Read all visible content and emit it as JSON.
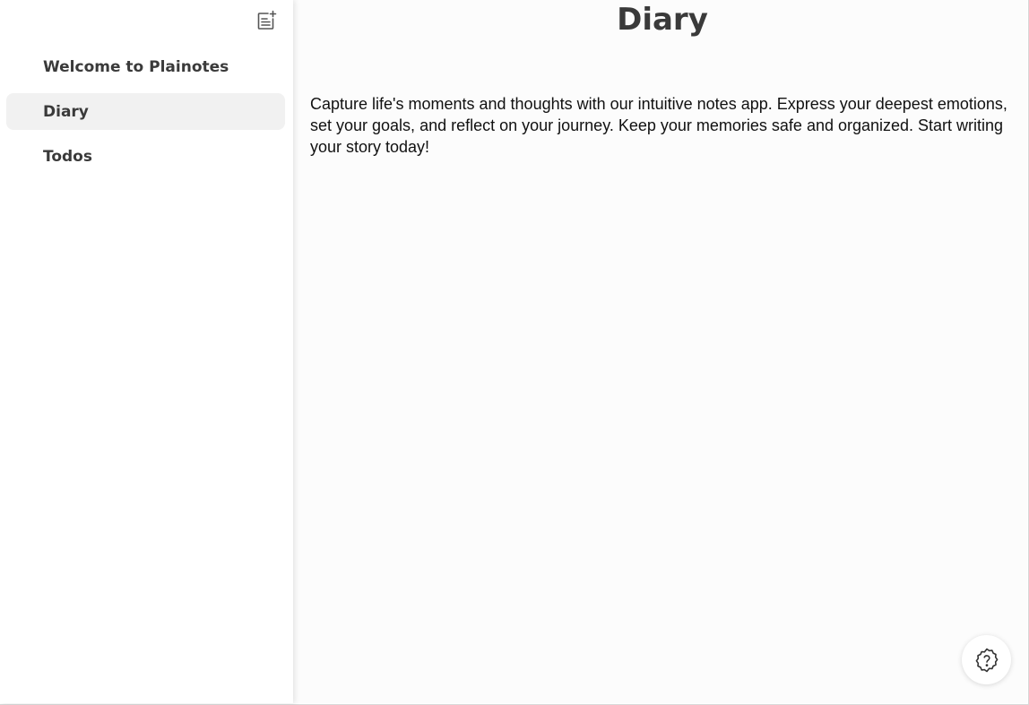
{
  "sidebar": {
    "new_note_icon": "note-add-icon",
    "items": [
      {
        "label": "Welcome to Plainotes",
        "active": false
      },
      {
        "label": "Diary",
        "active": true
      },
      {
        "label": "Todos",
        "active": false
      }
    ]
  },
  "main": {
    "title": "Diary",
    "body": "Capture life's moments and thoughts with our intuitive notes app. Express your deepest emotions, set your goals, and reflect on your journey. Keep your memories safe and organized. Start writing your story today!"
  },
  "help": {
    "icon": "help-badge-icon"
  },
  "colors": {
    "text": "#3a3a3a",
    "active_item_bg": "#f1f1f1",
    "main_bg": "#fcfcfc"
  }
}
